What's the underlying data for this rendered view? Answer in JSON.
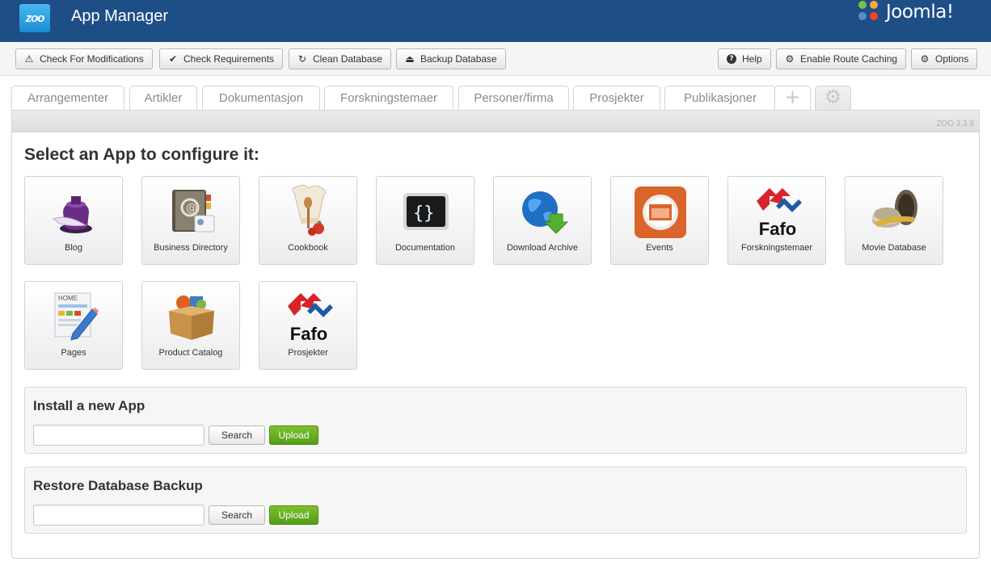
{
  "header": {
    "logo_text": "zoo",
    "title": "App Manager",
    "cms_brand": "Joomla!",
    "background_color": "#1d4e86"
  },
  "toolbar": {
    "left": [
      {
        "label": "Check For Modifications",
        "icon": "warning-icon",
        "glyph": "⚠"
      },
      {
        "label": "Check Requirements",
        "icon": "checkmark-icon",
        "glyph": "✔"
      },
      {
        "label": "Clean Database",
        "icon": "refresh-icon",
        "glyph": "↻"
      },
      {
        "label": "Backup Database",
        "icon": "drive-icon",
        "glyph": "⏏"
      }
    ],
    "right": [
      {
        "label": "Help",
        "icon": "question-icon",
        "glyph": "?"
      },
      {
        "label": "Enable Route Caching",
        "icon": "gear-icon",
        "glyph": "⚙"
      },
      {
        "label": "Options",
        "icon": "gear-icon",
        "glyph": "⚙"
      }
    ]
  },
  "tabs": [
    "Arrangementer",
    "Artikler",
    "Dokumentasjon",
    "Forskningstemaer",
    "Personer/firma",
    "Prosjekter",
    "Publikasjoner"
  ],
  "tab_icons": {
    "add": "+",
    "settings": "⚙"
  },
  "version": "ZOO 3.3.9",
  "heading": "Select an App to configure it:",
  "apps": [
    {
      "label": "Blog",
      "icon": "ink-quill-icon"
    },
    {
      "label": "Business Directory",
      "icon": "address-book-icon"
    },
    {
      "label": "Cookbook",
      "icon": "chef-hat-icon"
    },
    {
      "label": "Documentation",
      "icon": "code-braces-icon"
    },
    {
      "label": "Download Archive",
      "icon": "globe-download-icon"
    },
    {
      "label": "Events",
      "icon": "calendar-icon"
    },
    {
      "label": "Forskningstemaer",
      "icon": "fafo-logo-icon",
      "logo_text": "Fafo"
    },
    {
      "label": "Movie Database",
      "icon": "film-reel-icon"
    },
    {
      "label": "Pages",
      "icon": "pages-pencil-icon",
      "page_text": "HOME"
    },
    {
      "label": "Product Catalog",
      "icon": "product-box-icon"
    },
    {
      "label": "Prosjekter",
      "icon": "fafo-logo-icon",
      "logo_text": "Fafo"
    }
  ],
  "install": {
    "title": "Install a new App",
    "input_value": "",
    "search_label": "Search",
    "upload_label": "Upload"
  },
  "restore": {
    "title": "Restore Database Backup",
    "input_value": "",
    "search_label": "Search",
    "upload_label": "Upload"
  },
  "colors": {
    "upload_green": "#6bb321",
    "fafo_red": "#d8232a",
    "fafo_blue": "#1f5aa8",
    "events_orange": "#d9652b"
  }
}
